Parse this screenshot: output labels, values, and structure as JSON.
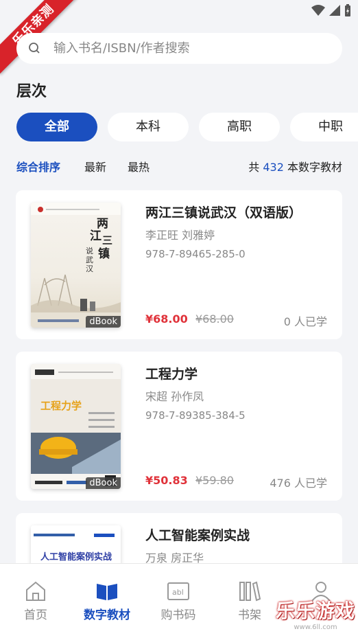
{
  "ribbon": "乐乐亲测",
  "search": {
    "placeholder": "输入书名/ISBN/作者搜索"
  },
  "section_title": "层次",
  "levels": [
    "全部",
    "本科",
    "高职",
    "中职"
  ],
  "sort": {
    "items": [
      "综合排序",
      "最新",
      "最热"
    ],
    "total_prefix": "共",
    "total_count": "432",
    "total_suffix": "本数字教材"
  },
  "books": [
    {
      "title": "两江三镇说武汉（双语版）",
      "authors": "李正旺 刘雅婷",
      "isbn": "978-7-89465-285-0",
      "price": "¥68.00",
      "orig_price": "¥68.00",
      "learners": "0 人已学",
      "badge": "dBook",
      "cover_title": "两江三镇说武汉"
    },
    {
      "title": "工程力学",
      "authors": "宋超 孙作凤",
      "isbn": "978-7-89385-384-5",
      "price": "¥50.83",
      "orig_price": "¥59.80",
      "learners": "476 人已学",
      "badge": "dBook",
      "cover_title": "工程力学"
    },
    {
      "title": "人工智能案例实战",
      "authors": "万泉 房正华",
      "cover_title": "人工智能案例实战"
    }
  ],
  "nav": [
    {
      "label": "首页",
      "icon": "home-icon"
    },
    {
      "label": "数字教材",
      "icon": "book-open-icon"
    },
    {
      "label": "购书码",
      "icon": "code-box-icon"
    },
    {
      "label": "书架",
      "icon": "bookshelf-icon"
    },
    {
      "label": "",
      "icon": "user-icon"
    }
  ],
  "watermark": {
    "text": "乐乐游戏",
    "url": "www.6ll.com"
  },
  "colors": {
    "accent": "#1b4fbf",
    "price": "#e0323a",
    "ribbon": "#d8232a"
  }
}
